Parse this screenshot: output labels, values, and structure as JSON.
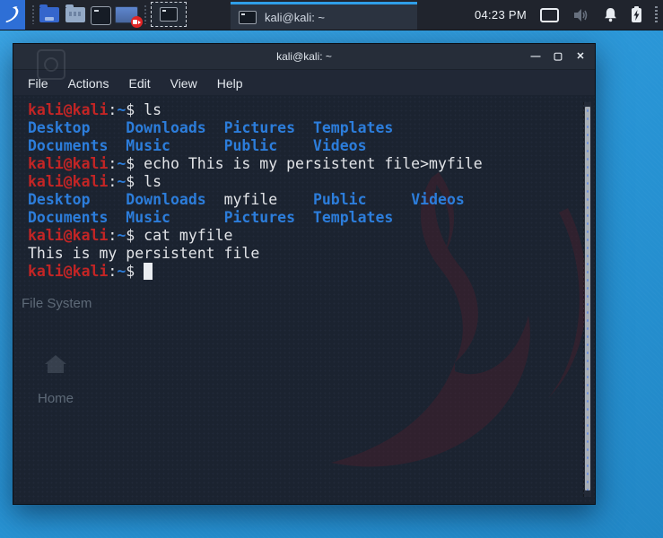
{
  "colors": {
    "accent": "#2f9ee8",
    "red": "#c32525",
    "blue": "#2c7ddb",
    "fg": "#e2e4e8",
    "termbg": "#1b2330",
    "panelbg": "#20242d",
    "kalibtn": "#2e6fd6",
    "desk1": "#3aa4e4",
    "desk2": "#2793d4",
    "desk3": "#2187c6"
  },
  "panel": {
    "launchers": [
      "kali-menu",
      "file-manager",
      "file-manager-light",
      "terminal-emulator",
      "screen-recorder"
    ],
    "workspace_switcher": "workspace-1-terminal",
    "taskbar": {
      "label": "kali@kali: ~"
    },
    "clock": "04:23 PM",
    "tray": [
      "display",
      "volume",
      "notifications",
      "battery"
    ]
  },
  "window": {
    "title": "kali@kali: ~",
    "controls": {
      "minimize": "—",
      "maximize": "▢",
      "close": "✕"
    },
    "menu": [
      "File",
      "Actions",
      "Edit",
      "View",
      "Help"
    ]
  },
  "terminal": {
    "lines": [
      [
        [
          "kali@kali",
          "red"
        ],
        [
          ":",
          "fg"
        ],
        [
          "~",
          "blue"
        ],
        [
          "$ ",
          "fg"
        ],
        [
          "ls",
          "fg"
        ]
      ],
      [
        [
          "Desktop",
          "dir"
        ],
        [
          "    ",
          "fg"
        ],
        [
          "Downloads",
          "dir"
        ],
        [
          "  ",
          "fg"
        ],
        [
          "Pictures",
          "dir"
        ],
        [
          "  ",
          "fg"
        ],
        [
          "Templates",
          "dir"
        ]
      ],
      [
        [
          "Documents",
          "dir"
        ],
        [
          "  ",
          "fg"
        ],
        [
          "Music",
          "dir"
        ],
        [
          "      ",
          "fg"
        ],
        [
          "Public",
          "dir"
        ],
        [
          "    ",
          "fg"
        ],
        [
          "Videos",
          "dir"
        ]
      ],
      [
        [
          "kali@kali",
          "red"
        ],
        [
          ":",
          "fg"
        ],
        [
          "~",
          "blue"
        ],
        [
          "$ ",
          "fg"
        ],
        [
          "echo This is my persistent file>myfile",
          "fg"
        ]
      ],
      [
        [
          "kali@kali",
          "red"
        ],
        [
          ":",
          "fg"
        ],
        [
          "~",
          "blue"
        ],
        [
          "$ ",
          "fg"
        ],
        [
          "ls",
          "fg"
        ]
      ],
      [
        [
          "Desktop",
          "dir"
        ],
        [
          "    ",
          "fg"
        ],
        [
          "Downloads",
          "dir"
        ],
        [
          "  ",
          "fg"
        ],
        [
          "myfile",
          "fg"
        ],
        [
          "    ",
          "fg"
        ],
        [
          "Public",
          "dir"
        ],
        [
          "     ",
          "fg"
        ],
        [
          "Videos",
          "dir"
        ]
      ],
      [
        [
          "Documents",
          "dir"
        ],
        [
          "  ",
          "fg"
        ],
        [
          "Music",
          "dir"
        ],
        [
          "      ",
          "fg"
        ],
        [
          "Pictures",
          "dir"
        ],
        [
          "  ",
          "fg"
        ],
        [
          "Templates",
          "dir"
        ]
      ],
      [
        [
          "kali@kali",
          "red"
        ],
        [
          ":",
          "fg"
        ],
        [
          "~",
          "blue"
        ],
        [
          "$ ",
          "fg"
        ],
        [
          "cat myfile",
          "fg"
        ]
      ],
      [
        [
          "This is my persistent file",
          "fg"
        ]
      ],
      [
        [
          "kali@kali",
          "red"
        ],
        [
          ":",
          "fg"
        ],
        [
          "~",
          "blue"
        ],
        [
          "$ ",
          "fg"
        ],
        [
          " ",
          "cursor"
        ]
      ]
    ]
  },
  "desktop": {
    "icons": [
      {
        "label": "File System"
      },
      {
        "label": "Home"
      }
    ]
  }
}
